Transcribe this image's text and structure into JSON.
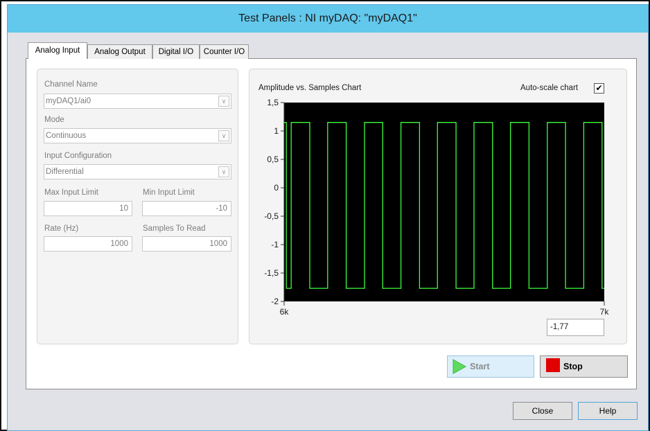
{
  "window": {
    "title": "Test Panels : NI myDAQ: \"myDAQ1\""
  },
  "tabs": [
    {
      "label": "Analog Input",
      "active": true
    },
    {
      "label": "Analog Output",
      "active": false
    },
    {
      "label": "Digital I/O",
      "active": false
    },
    {
      "label": "Counter I/O",
      "active": false
    }
  ],
  "settings": {
    "channel_name": {
      "label": "Channel Name",
      "value": "myDAQ1/ai0"
    },
    "mode": {
      "label": "Mode",
      "value": "Continuous"
    },
    "input_configuration": {
      "label": "Input Configuration",
      "value": "Differential"
    },
    "max_input_limit": {
      "label": "Max Input Limit",
      "value": "10"
    },
    "min_input_limit": {
      "label": "Min Input Limit",
      "value": "-10"
    },
    "rate": {
      "label": "Rate (Hz)",
      "value": "1000"
    },
    "samples_to_read": {
      "label": "Samples To Read",
      "value": "1000"
    }
  },
  "chart": {
    "title": "Amplitude vs. Samples Chart",
    "autoscale_label": "Auto-scale chart",
    "autoscale_checked": true,
    "readout": "-1,77"
  },
  "chart_data": {
    "type": "line",
    "title": "Amplitude vs. Samples Chart",
    "xlabel": "",
    "ylabel": "",
    "xlim": [
      6000,
      7000
    ],
    "ylim": [
      -2,
      1.5
    ],
    "x_tick_labels": [
      "6k",
      "7k"
    ],
    "y_tick_labels": [
      "1,5",
      "1",
      "0,5",
      "0",
      "-0,5",
      "-1",
      "-1,5",
      "-2"
    ],
    "y_ticks": [
      1.5,
      1,
      0.5,
      0,
      -0.5,
      -1,
      -1.5,
      -2
    ],
    "grid": false,
    "background": "#000000",
    "line_color": "#3cff3c",
    "series": [
      {
        "waveform": "square",
        "high": 1.15,
        "low": -1.77,
        "cycles_shown": 8.6,
        "x": [
          6000,
          6007,
          6007,
          6022,
          6022,
          6080,
          6080,
          6136,
          6136,
          6194,
          6194,
          6251,
          6251,
          6308,
          6308,
          6365,
          6365,
          6423,
          6423,
          6479,
          6479,
          6537,
          6537,
          6593,
          6593,
          6651,
          6651,
          6707,
          6707,
          6765,
          6765,
          6822,
          6822,
          6879,
          6879,
          6936,
          6936,
          6993,
          6993,
          7000
        ],
        "y": [
          1.15,
          1.15,
          -1.77,
          -1.77,
          1.15,
          1.15,
          -1.77,
          -1.77,
          1.15,
          1.15,
          -1.77,
          -1.77,
          1.15,
          1.15,
          -1.77,
          -1.77,
          1.15,
          1.15,
          -1.77,
          -1.77,
          1.15,
          1.15,
          -1.77,
          -1.77,
          1.15,
          1.15,
          -1.77,
          -1.77,
          1.15,
          1.15,
          -1.77,
          -1.77,
          1.15,
          1.15,
          -1.77,
          -1.77,
          1.15,
          1.15,
          -1.77,
          -1.77
        ]
      }
    ]
  },
  "buttons": {
    "start": "Start",
    "stop": "Stop",
    "close": "Close",
    "help": "Help"
  },
  "colors": {
    "titlebar": "#62c8ec",
    "stop_icon": "#e00000",
    "start_icon": "#5edc5e",
    "plot_bg": "#000000",
    "trace": "#3cff3c"
  }
}
